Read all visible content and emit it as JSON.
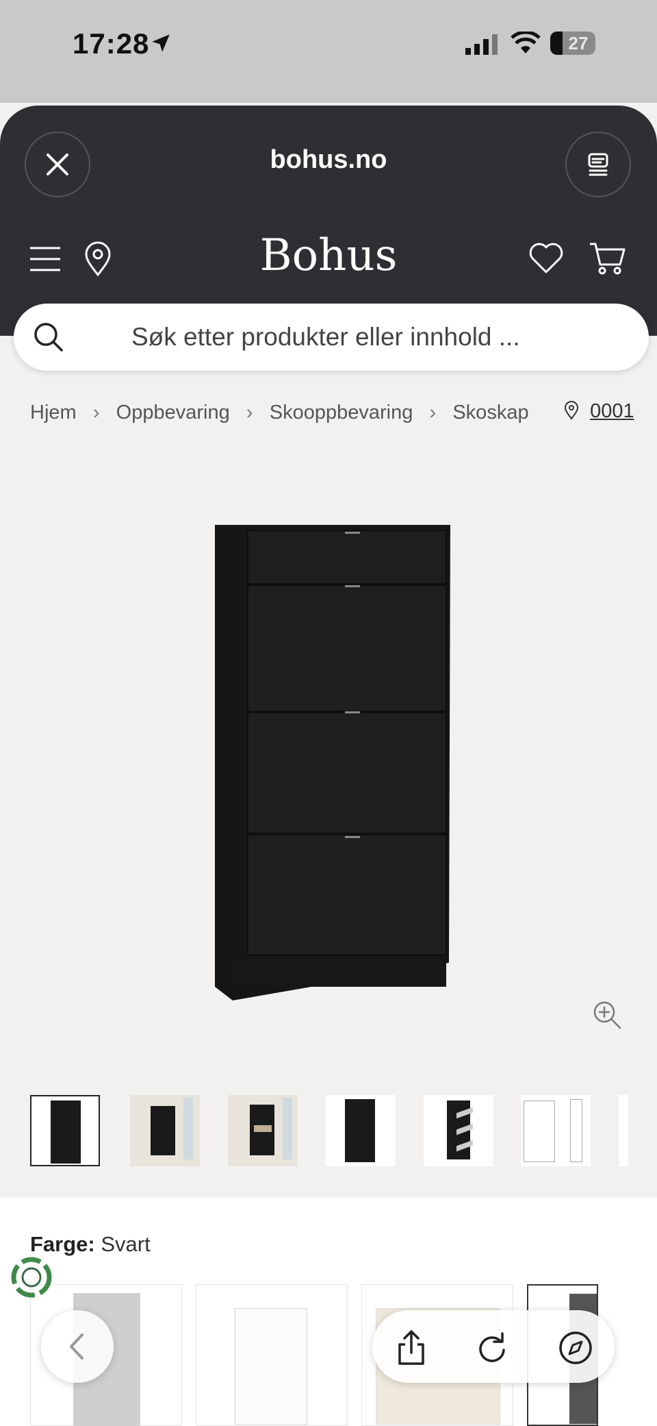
{
  "status": {
    "time": "17:28",
    "battery": "27"
  },
  "browser": {
    "domain": "bohus.no"
  },
  "header": {
    "logo": "Bohus"
  },
  "search": {
    "placeholder": "Søk etter produkter eller innhold ..."
  },
  "breadcrumb": {
    "items": [
      "Hjem",
      "Oppbevaring",
      "Skooppbevaring",
      "Skoskap"
    ],
    "store": "0001"
  },
  "product": {
    "color_label": "Farge:",
    "color_value": "Svart"
  },
  "thumbnails": [
    {
      "name": "black-cabinet-front",
      "selected": true
    },
    {
      "name": "room-scene-closed"
    },
    {
      "name": "room-scene-open"
    },
    {
      "name": "black-cabinet-front-alt"
    },
    {
      "name": "black-cabinet-open"
    },
    {
      "name": "line-drawing"
    }
  ],
  "colors": {
    "accent": "#2f2e33",
    "background": "#f2f1f0",
    "product": "#1c1c1c"
  }
}
